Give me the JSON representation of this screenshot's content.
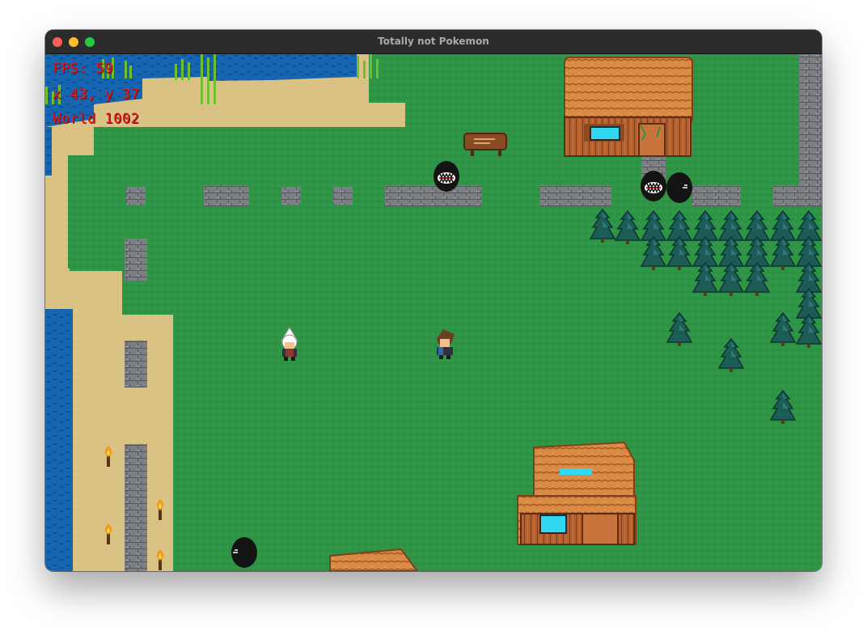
{
  "window": {
    "title": "Totally not Pokemon"
  },
  "hud": {
    "fps": "FPS: 59",
    "position": "x 43, y 37",
    "world": "World 1002"
  },
  "colors": {
    "grass": "#2f9446",
    "sand": "#d9c283",
    "water": "#1565b0",
    "hud_text": "#e31b1b",
    "roof": "#d98a45",
    "wall": "#b5602e",
    "stone": "#7c7f83",
    "tree": "#1d5b57"
  },
  "icons": [
    "player-character-sprite",
    "npc-character-sprite",
    "shadow-monster-sprite",
    "tree-icon",
    "torch-icon",
    "signpost-icon",
    "house-icon"
  ]
}
